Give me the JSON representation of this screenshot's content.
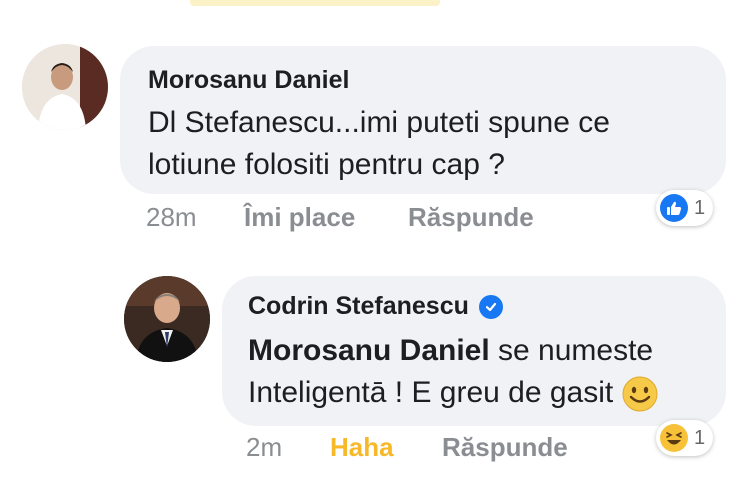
{
  "comments": [
    {
      "author": "Morosanu Daniel",
      "text": "Dl Stefanescu...imi puteti spune ce",
      "text_line2": "lotiune folositi pentru cap ?",
      "time": "28m",
      "like_label": "Îmi place",
      "reply_label": "Răspunde",
      "reaction_icon": "like-icon",
      "reaction_count": "1"
    },
    {
      "author": "Codrin Stefanescu",
      "verified_icon": "verified-badge-icon",
      "mention": "Morosanu Daniel",
      "text": " se numeste",
      "text_line2": "Inteligentā ! E greu de gasit",
      "emoji": "smiley-emoji-icon",
      "time": "2m",
      "like_label": "Haha",
      "reply_label": "Răspunde",
      "reaction_icon": "haha-icon",
      "reaction_count": "1"
    }
  ],
  "colors": {
    "bubble": "#f0f2f5",
    "meta": "#8a8d91",
    "haha": "#f7b928",
    "like_blue": "#1877f2"
  }
}
